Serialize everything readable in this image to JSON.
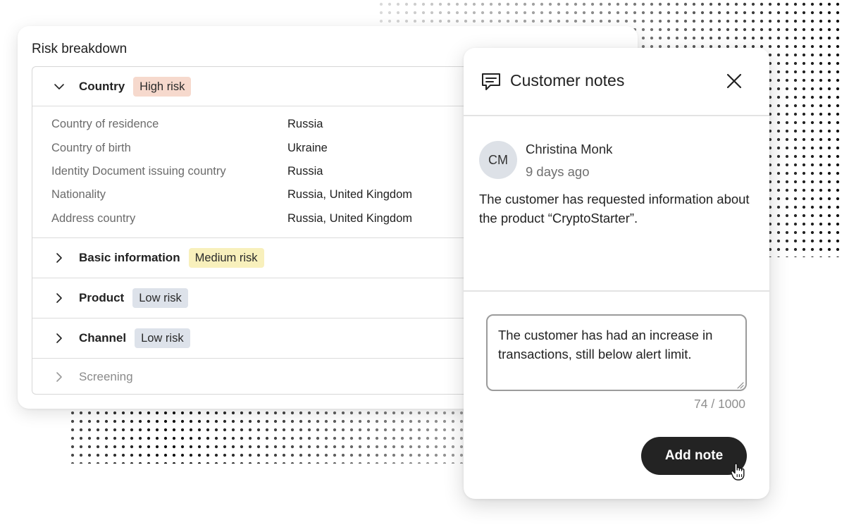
{
  "risk_breakdown": {
    "title": "Risk breakdown",
    "sections": [
      {
        "label": "Country",
        "badge": "High risk",
        "badge_color": "#f6d9cd",
        "expanded": true,
        "icon": "chevron-down-icon"
      },
      {
        "label": "Basic information",
        "badge": "Medium risk",
        "badge_color": "#f8f0bc",
        "expanded": false,
        "icon": "chevron-right-icon"
      },
      {
        "label": "Product",
        "badge": "Low risk",
        "badge_color": "#dde2ea",
        "expanded": false,
        "icon": "chevron-right-icon"
      },
      {
        "label": "Channel",
        "badge": "Low risk",
        "badge_color": "#dde2ea",
        "expanded": false,
        "icon": "chevron-right-icon"
      },
      {
        "label": "Screening",
        "badge": "",
        "expanded": false,
        "disabled": true,
        "icon": "chevron-right-icon"
      }
    ],
    "country_rows": [
      {
        "label": "Country of residence",
        "value": "Russia"
      },
      {
        "label": "Country of birth",
        "value": "Ukraine"
      },
      {
        "label": "Identity Document issuing country",
        "value": "Russia"
      },
      {
        "label": "Nationality",
        "value": "Russia, United Kingdom"
      },
      {
        "label": "Address country",
        "value": "Russia, United Kingdom"
      }
    ]
  },
  "notes_panel": {
    "title": "Customer notes",
    "header_icon": "comment-icon",
    "close_icon": "close-icon",
    "note": {
      "avatar_initials": "CM",
      "author": "Christina Monk",
      "time": "9 days ago",
      "body": "The customer has requested information about the product “CryptoStarter”."
    },
    "input": {
      "value": "The customer has had an increase in transactions, still below alert limit.",
      "counter": "74 / 1000"
    },
    "add_button_label": "Add note",
    "button_color": "#232323"
  }
}
